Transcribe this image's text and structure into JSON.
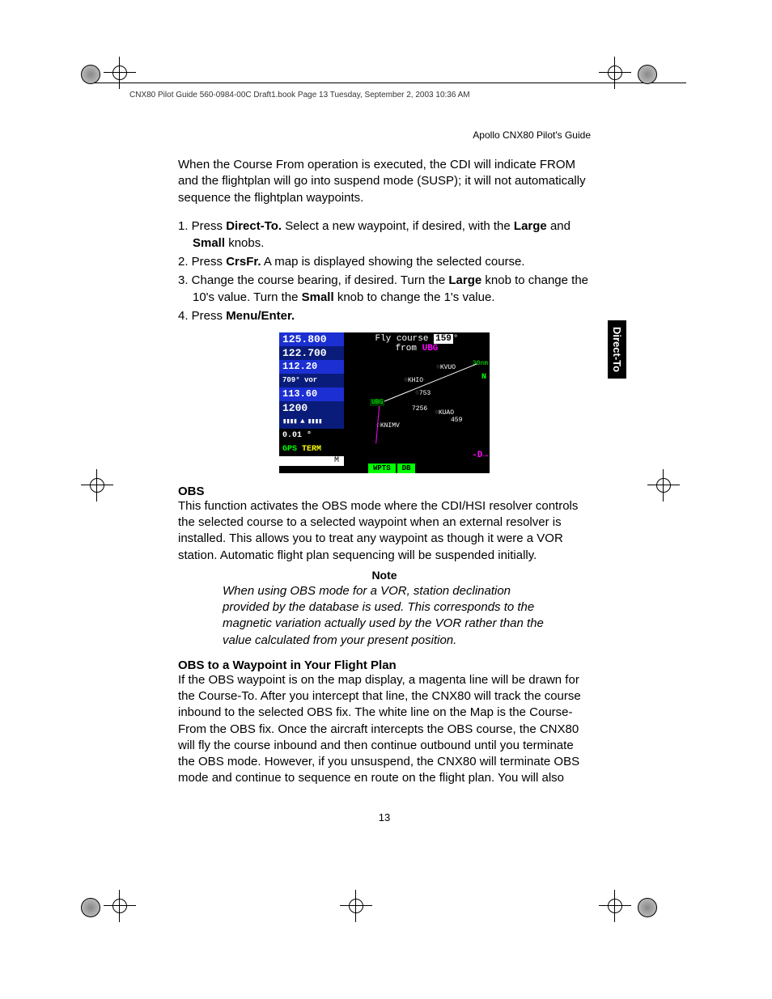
{
  "book_header": "CNX80 Pilot Guide 560-0984-00C Draft1.book  Page 13  Tuesday, September 2, 2003  10:36 AM",
  "guide_title": "Apollo CNX80 Pilot's Guide",
  "side_tab": "Direct-To",
  "intro_para": "When the Course From operation is executed, the CDI will indicate FROM and the flightplan will go into suspend mode (SUSP); it will not automatically sequence the flightplan waypoints.",
  "steps": {
    "s1a": "1. Press ",
    "s1b": "Direct-To.",
    "s1c": " Select a new waypoint, if desired, with the ",
    "s1d": "Large",
    "s1e": " and ",
    "s1f": "Small",
    "s1g": " knobs.",
    "s2a": "2. Press ",
    "s2b": "CrsFr.",
    "s2c": " A map is displayed showing the selected course.",
    "s3a": "3. Change the course bearing, if desired. Turn the ",
    "s3b": "Large",
    "s3c": " knob to change the 10's value. Turn the ",
    "s3d": "Small",
    "s3e": " knob to change the 1's value.",
    "s4a": "4. Press ",
    "s4b": "Menu/Enter."
  },
  "device": {
    "left_rows": {
      "r1": "125.800",
      "r2": "122.700",
      "r3": "112.20",
      "r4": "709°   vor",
      "r5": "113.60",
      "r6": "1200",
      "bars": "▮▮▮▮ ▲ ▮▮▮▮",
      "dist": "0.01 °",
      "gps_g": "GPS",
      "gps_t": " TERM",
      "m": "M"
    },
    "title_pre": "Fly course ",
    "title_val": "159",
    "title_post": "°",
    "sub_pre": "from ",
    "sub_wp": "UBG",
    "nm": "30nm",
    "n": "N",
    "labels": {
      "kvuo": "KVUO",
      "khio": "KHIO",
      "n753": "753",
      "ubg": "UBG",
      "n256": "7256",
      "kuao": "KUAO",
      "n459": "459",
      "knimv": "KNIMV"
    },
    "arrow_d": "-D→",
    "softkeys": {
      "wpts": "WPTS",
      "db": "DB"
    }
  },
  "obs_heading": "OBS",
  "obs_para": "This function activates the OBS mode where the CDI/HSI resolver controls the selected course to a selected waypoint when an external resolver is installed. This allows you to treat any waypoint as though it were a VOR station. Automatic flight plan sequencing will be suspended initially.",
  "note_label": "Note",
  "note_body": "When using OBS mode for a VOR, station declination provided by the database is used. This corresponds to the magnetic variation actually used by the VOR rather than the value calculated from your present position.",
  "obs_wp_heading": "OBS to a Waypoint in Your Flight Plan",
  "obs_wp_para": "If the OBS waypoint is on the map display, a magenta line will be drawn for the Course-To. After you intercept that line, the CNX80 will track the course inbound to the selected OBS fix. The white line on the Map is the Course-From the OBS fix. Once the aircraft intercepts the OBS course, the CNX80 will fly the course inbound and then continue outbound until you terminate the OBS mode. However, if you unsuspend, the CNX80 will terminate OBS mode and continue to sequence en route on the flight plan. You will also",
  "page_number": "13"
}
